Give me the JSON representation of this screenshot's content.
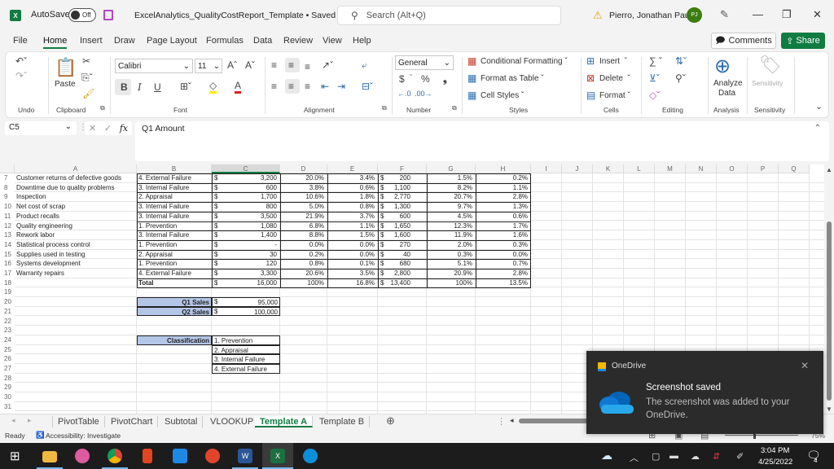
{
  "titlebar": {
    "app_icon": "X",
    "autosave_label": "AutoSave",
    "autosave_state": "Off",
    "file_title": "ExcelAnalytics_QualityCostReport_Template • Saved",
    "search_placeholder": "Search (Alt+Q)",
    "user_name": "Pierro, Jonathan Paul",
    "user_initials": "PJ"
  },
  "menu": [
    "File",
    "Home",
    "Insert",
    "Draw",
    "Page Layout",
    "Formulas",
    "Data",
    "Review",
    "View",
    "Help"
  ],
  "menu_active": "Home",
  "actions": {
    "comments": "Comments",
    "share": "Share"
  },
  "ribbon": {
    "groups": {
      "undo": "Undo",
      "clipboard": "Clipboard",
      "font": "Font",
      "alignment": "Alignment",
      "number": "Number",
      "styles": "Styles",
      "cells": "Cells",
      "editing": "Editing",
      "analysis": "Analysis",
      "sensitivity": "Sensitivity"
    },
    "paste": "Paste",
    "font_name": "Calibri",
    "font_size": "11",
    "number_format": "General",
    "conditional_formatting": "Conditional Formatting",
    "format_as_table": "Format as Table",
    "cell_styles": "Cell Styles",
    "insert": "Insert",
    "delete": "Delete",
    "format": "Format",
    "analyze_data_1": "Analyze",
    "analyze_data_2": "Data",
    "sensitivity_btn": "Sensitivity",
    "bold": "B",
    "italic": "I",
    "underline": "U",
    "dollar": "$",
    "percent": "%",
    "comma": "9"
  },
  "formula_bar": {
    "name_box": "C5",
    "formula": "Q1 Amount"
  },
  "columns": [
    "A",
    "B",
    "C",
    "D",
    "E",
    "F",
    "G",
    "H",
    "I",
    "J",
    "K",
    "L",
    "M",
    "N",
    "O",
    "P",
    "Q"
  ],
  "rows": [
    {
      "n": "7",
      "a": "Customer returns of defective goods",
      "b": "4. External Failure",
      "c": "3,200",
      "d": "20.0%",
      "e": "3.4%",
      "f": "200",
      "g": "1.5%",
      "h": "0.2%"
    },
    {
      "n": "8",
      "a": "Downtime due to quality problems",
      "b": "3. Internal Failure",
      "c": "600",
      "d": "3.8%",
      "e": "0.6%",
      "f": "1,100",
      "g": "8.2%",
      "h": "1.1%"
    },
    {
      "n": "9",
      "a": "Inspection",
      "b": "2. Appraisal",
      "c": "1,700",
      "d": "10.6%",
      "e": "1.8%",
      "f": "2,770",
      "g": "20.7%",
      "h": "2.8%"
    },
    {
      "n": "10",
      "a": "Net cost of scrap",
      "b": "3. Internal Failure",
      "c": "800",
      "d": "5.0%",
      "e": "0.8%",
      "f": "1,300",
      "g": "9.7%",
      "h": "1.3%"
    },
    {
      "n": "11",
      "a": "Product recalls",
      "b": "3. Internal Failure",
      "c": "3,500",
      "d": "21.9%",
      "e": "3.7%",
      "f": "600",
      "g": "4.5%",
      "h": "0.6%"
    },
    {
      "n": "12",
      "a": "Quality engineering",
      "b": "1. Prevention",
      "c": "1,080",
      "d": "6.8%",
      "e": "1.1%",
      "f": "1,650",
      "g": "12.3%",
      "h": "1.7%"
    },
    {
      "n": "13",
      "a": "Rework labor",
      "b": "3. Internal Failure",
      "c": "1,400",
      "d": "8.8%",
      "e": "1.5%",
      "f": "1,600",
      "g": "11.9%",
      "h": "1.6%"
    },
    {
      "n": "14",
      "a": "Statistical process control",
      "b": "1. Prevention",
      "c": "-",
      "d": "0.0%",
      "e": "0.0%",
      "f": "270",
      "g": "2.0%",
      "h": "0.3%"
    },
    {
      "n": "15",
      "a": "Supplies used in testing",
      "b": "2. Appraisal",
      "c": "30",
      "d": "0.2%",
      "e": "0.0%",
      "f": "40",
      "g": "0.3%",
      "h": "0.0%"
    },
    {
      "n": "16",
      "a": "Systems development",
      "b": "1. Prevention",
      "c": "120",
      "d": "0.8%",
      "e": "0.1%",
      "f": "680",
      "g": "5.1%",
      "h": "0.7%"
    },
    {
      "n": "17",
      "a": "Warranty repairs",
      "b": "4. External Failure",
      "c": "3,300",
      "d": "20.6%",
      "e": "3.5%",
      "f": "2,800",
      "g": "20.9%",
      "h": "2.8%"
    },
    {
      "n": "18",
      "a": "",
      "b": "Total",
      "c": "16,000",
      "d": "100%",
      "e": "16.8%",
      "f": "13,400",
      "g": "100%",
      "h": "13.5%"
    }
  ],
  "currency_symbol": "$",
  "empty_rows": [
    "19",
    "20",
    "21",
    "22",
    "23",
    "24",
    "25",
    "26",
    "27",
    "28",
    "29",
    "30",
    "31"
  ],
  "sales": [
    {
      "label": "Q1 Sales",
      "value": "95,000"
    },
    {
      "label": "Q2 Sales",
      "value": "100,000"
    }
  ],
  "classification": {
    "label": "Classification",
    "items": [
      "1. Prevention",
      "2. Appraisal",
      "3. Internal Failure",
      "4. External Failure"
    ]
  },
  "sheet_tabs": [
    "PivotTable",
    "PivotChart",
    "Subtotal",
    "VLOOKUP",
    "Template A",
    "Template B"
  ],
  "active_tab": "Template A",
  "status": {
    "ready": "Ready",
    "accessibility": "Accessibility: Investigate",
    "zoom": "75%"
  },
  "toast": {
    "app": "OneDrive",
    "title": "Screenshot saved",
    "body": "The screenshot was added to your OneDrive."
  },
  "clock": {
    "time": "3:04 PM",
    "date": "4/25/2022",
    "notifications": "4"
  }
}
